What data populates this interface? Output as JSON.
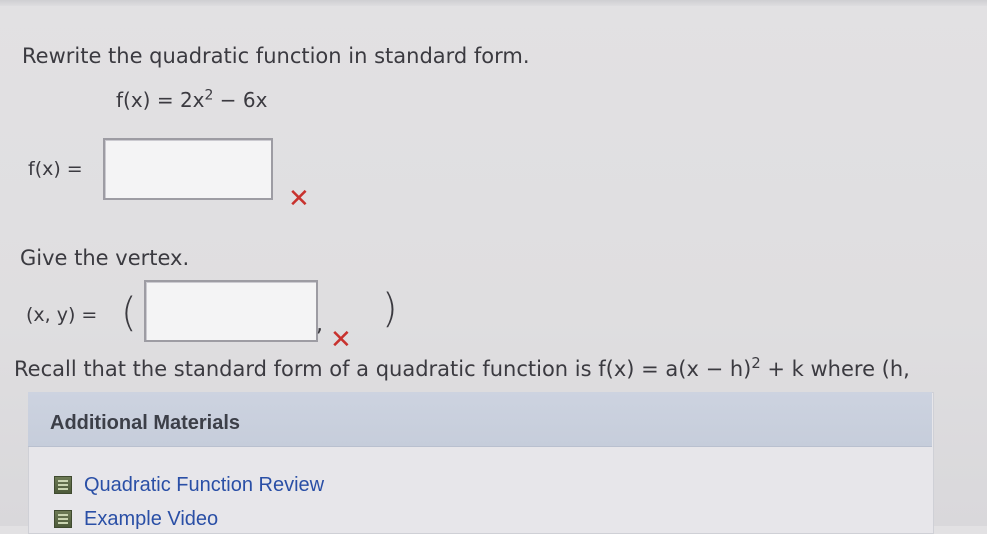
{
  "question": {
    "instruction": "Rewrite the quadratic function in standard form.",
    "given": {
      "lhs": "f(x) = 2x",
      "exponent": "2",
      "rest": " − 6x"
    },
    "answer_label": "f(x) =",
    "answer_value": "",
    "answer_status_mark": "✕",
    "vertex_prompt": "Give the vertex.",
    "vertex_label": "(x, y) =",
    "vertex_open_paren": "(",
    "vertex_value": "",
    "vertex_separator": ",",
    "vertex_close_paren": ")",
    "vertex_status_mark": "✕",
    "recall": {
      "lead": "Recall that the standard form of a quadratic function is ",
      "formula_start": "f(x) = a(x − h)",
      "exponent": "2",
      "formula_end": " + k",
      "tail": " where (h,"
    }
  },
  "additional_materials": {
    "title": "Additional Materials",
    "items": [
      {
        "label": "Quadratic Function Review"
      },
      {
        "label": "Example Video"
      }
    ]
  },
  "colors": {
    "wrong": "#c8322e",
    "link": "#2a4fa6",
    "panel_header": "#c6cddb"
  }
}
